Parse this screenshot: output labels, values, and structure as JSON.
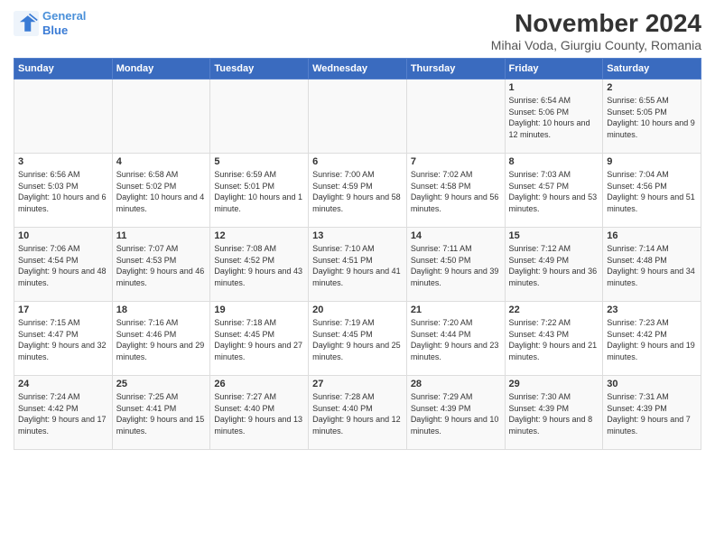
{
  "header": {
    "logo_line1": "General",
    "logo_line2": "Blue",
    "title": "November 2024",
    "subtitle": "Mihai Voda, Giurgiu County, Romania"
  },
  "columns": [
    "Sunday",
    "Monday",
    "Tuesday",
    "Wednesday",
    "Thursday",
    "Friday",
    "Saturday"
  ],
  "weeks": [
    [
      {
        "day": "",
        "info": ""
      },
      {
        "day": "",
        "info": ""
      },
      {
        "day": "",
        "info": ""
      },
      {
        "day": "",
        "info": ""
      },
      {
        "day": "",
        "info": ""
      },
      {
        "day": "1",
        "info": "Sunrise: 6:54 AM\nSunset: 5:06 PM\nDaylight: 10 hours and 12 minutes."
      },
      {
        "day": "2",
        "info": "Sunrise: 6:55 AM\nSunset: 5:05 PM\nDaylight: 10 hours and 9 minutes."
      }
    ],
    [
      {
        "day": "3",
        "info": "Sunrise: 6:56 AM\nSunset: 5:03 PM\nDaylight: 10 hours and 6 minutes."
      },
      {
        "day": "4",
        "info": "Sunrise: 6:58 AM\nSunset: 5:02 PM\nDaylight: 10 hours and 4 minutes."
      },
      {
        "day": "5",
        "info": "Sunrise: 6:59 AM\nSunset: 5:01 PM\nDaylight: 10 hours and 1 minute."
      },
      {
        "day": "6",
        "info": "Sunrise: 7:00 AM\nSunset: 4:59 PM\nDaylight: 9 hours and 58 minutes."
      },
      {
        "day": "7",
        "info": "Sunrise: 7:02 AM\nSunset: 4:58 PM\nDaylight: 9 hours and 56 minutes."
      },
      {
        "day": "8",
        "info": "Sunrise: 7:03 AM\nSunset: 4:57 PM\nDaylight: 9 hours and 53 minutes."
      },
      {
        "day": "9",
        "info": "Sunrise: 7:04 AM\nSunset: 4:56 PM\nDaylight: 9 hours and 51 minutes."
      }
    ],
    [
      {
        "day": "10",
        "info": "Sunrise: 7:06 AM\nSunset: 4:54 PM\nDaylight: 9 hours and 48 minutes."
      },
      {
        "day": "11",
        "info": "Sunrise: 7:07 AM\nSunset: 4:53 PM\nDaylight: 9 hours and 46 minutes."
      },
      {
        "day": "12",
        "info": "Sunrise: 7:08 AM\nSunset: 4:52 PM\nDaylight: 9 hours and 43 minutes."
      },
      {
        "day": "13",
        "info": "Sunrise: 7:10 AM\nSunset: 4:51 PM\nDaylight: 9 hours and 41 minutes."
      },
      {
        "day": "14",
        "info": "Sunrise: 7:11 AM\nSunset: 4:50 PM\nDaylight: 9 hours and 39 minutes."
      },
      {
        "day": "15",
        "info": "Sunrise: 7:12 AM\nSunset: 4:49 PM\nDaylight: 9 hours and 36 minutes."
      },
      {
        "day": "16",
        "info": "Sunrise: 7:14 AM\nSunset: 4:48 PM\nDaylight: 9 hours and 34 minutes."
      }
    ],
    [
      {
        "day": "17",
        "info": "Sunrise: 7:15 AM\nSunset: 4:47 PM\nDaylight: 9 hours and 32 minutes."
      },
      {
        "day": "18",
        "info": "Sunrise: 7:16 AM\nSunset: 4:46 PM\nDaylight: 9 hours and 29 minutes."
      },
      {
        "day": "19",
        "info": "Sunrise: 7:18 AM\nSunset: 4:45 PM\nDaylight: 9 hours and 27 minutes."
      },
      {
        "day": "20",
        "info": "Sunrise: 7:19 AM\nSunset: 4:45 PM\nDaylight: 9 hours and 25 minutes."
      },
      {
        "day": "21",
        "info": "Sunrise: 7:20 AM\nSunset: 4:44 PM\nDaylight: 9 hours and 23 minutes."
      },
      {
        "day": "22",
        "info": "Sunrise: 7:22 AM\nSunset: 4:43 PM\nDaylight: 9 hours and 21 minutes."
      },
      {
        "day": "23",
        "info": "Sunrise: 7:23 AM\nSunset: 4:42 PM\nDaylight: 9 hours and 19 minutes."
      }
    ],
    [
      {
        "day": "24",
        "info": "Sunrise: 7:24 AM\nSunset: 4:42 PM\nDaylight: 9 hours and 17 minutes."
      },
      {
        "day": "25",
        "info": "Sunrise: 7:25 AM\nSunset: 4:41 PM\nDaylight: 9 hours and 15 minutes."
      },
      {
        "day": "26",
        "info": "Sunrise: 7:27 AM\nSunset: 4:40 PM\nDaylight: 9 hours and 13 minutes."
      },
      {
        "day": "27",
        "info": "Sunrise: 7:28 AM\nSunset: 4:40 PM\nDaylight: 9 hours and 12 minutes."
      },
      {
        "day": "28",
        "info": "Sunrise: 7:29 AM\nSunset: 4:39 PM\nDaylight: 9 hours and 10 minutes."
      },
      {
        "day": "29",
        "info": "Sunrise: 7:30 AM\nSunset: 4:39 PM\nDaylight: 9 hours and 8 minutes."
      },
      {
        "day": "30",
        "info": "Sunrise: 7:31 AM\nSunset: 4:39 PM\nDaylight: 9 hours and 7 minutes."
      }
    ]
  ]
}
